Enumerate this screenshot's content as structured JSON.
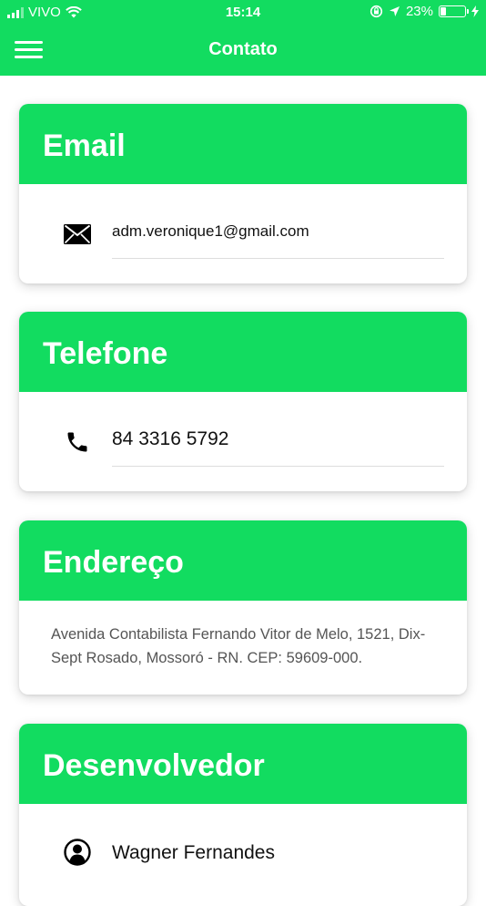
{
  "status_bar": {
    "carrier": "VIVO",
    "time": "15:14",
    "battery": "23%"
  },
  "header": {
    "title": "Contato"
  },
  "cards": {
    "email": {
      "title": "Email",
      "value": "adm.veronique1@gmail.com",
      "icon": "mail-icon"
    },
    "phone": {
      "title": "Telefone",
      "value": "84 3316 5792",
      "icon": "phone-icon"
    },
    "address": {
      "title": "Endereço",
      "value": "Avenida Contabilista Fernando Vitor de Melo, 1521, Dix-Sept Rosado, Mossoró - RN. CEP: 59609-000."
    },
    "developer": {
      "title": "Desenvolvedor",
      "value": "Wagner Fernandes",
      "icon": "user-icon"
    }
  },
  "colors": {
    "primary": "#12dc60",
    "background": "#ffffff",
    "text": "#111111",
    "muted_text": "#555555"
  }
}
